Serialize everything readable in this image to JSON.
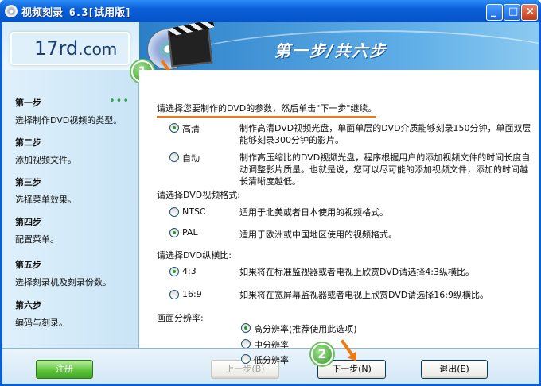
{
  "window": {
    "title": "视频刻录 6.3[试用版]"
  },
  "sidebar": {
    "logo": "17rd",
    "logo_suffix": ".com",
    "steps": [
      {
        "title": "第一步",
        "desc": "选择制作DVD视频的类型。"
      },
      {
        "title": "第二步",
        "desc": "添加视频文件。"
      },
      {
        "title": "第三步",
        "desc": "选择菜单效果。"
      },
      {
        "title": "第四步",
        "desc": "配置菜单。"
      },
      {
        "title": "第五步",
        "desc": "选择刻录机及刻录份数。"
      },
      {
        "title": "第六步",
        "desc": "编码与刻录。"
      }
    ],
    "current_indicator": "•••"
  },
  "header": {
    "title": "第一步/共六步"
  },
  "content": {
    "badge1": "1",
    "badge2": "2",
    "instruction": "请选择您要制作的DVD的参数，然后单击\"下一步\"继续。",
    "type_options": [
      {
        "label": "高清",
        "checked": true,
        "desc": "制作高清DVD视频光盘，单面单层的DVD介质能够刻录150分钟，单面双层能够刻录300分钟的影片。"
      },
      {
        "label": "自动",
        "checked": false,
        "desc": "制作高压缩比的DVD视频光盘，程序根据用户的添加视频文件的时间长度自动调整影片质量。也就是说，您可以尽可能的添加视频文件，添加的时间越长清晰度越低。"
      }
    ],
    "format_label": "请选择DVD视频格式:",
    "format_options": [
      {
        "label": "NTSC",
        "checked": false,
        "desc": "适用于北美或者日本使用的视频格式。"
      },
      {
        "label": "PAL",
        "checked": true,
        "desc": "适用于欧洲或中国地区使用的视频格式。"
      }
    ],
    "aspect_label": "请选择DVD纵横比:",
    "aspect_options": [
      {
        "label": "4:3",
        "checked": true,
        "desc": "如果将在标准监视器或者电视上欣赏DVD请选择4:3纵横比。"
      },
      {
        "label": "16:9",
        "checked": false,
        "desc": "如果将在宽屏幕监视器或者电视上欣赏DVD请选择16:9纵横比。"
      }
    ],
    "resolution_label": "画面分辨率:",
    "resolution_options": [
      {
        "label": "高分辨率(推荐使用此选项)",
        "checked": true
      },
      {
        "label": "中分辨率",
        "checked": false
      },
      {
        "label": "低分辨率",
        "checked": false
      }
    ]
  },
  "footer": {
    "register": "注册",
    "prev": "上一步(B)",
    "next": "下一步(N)",
    "exit": "退出(E)"
  }
}
